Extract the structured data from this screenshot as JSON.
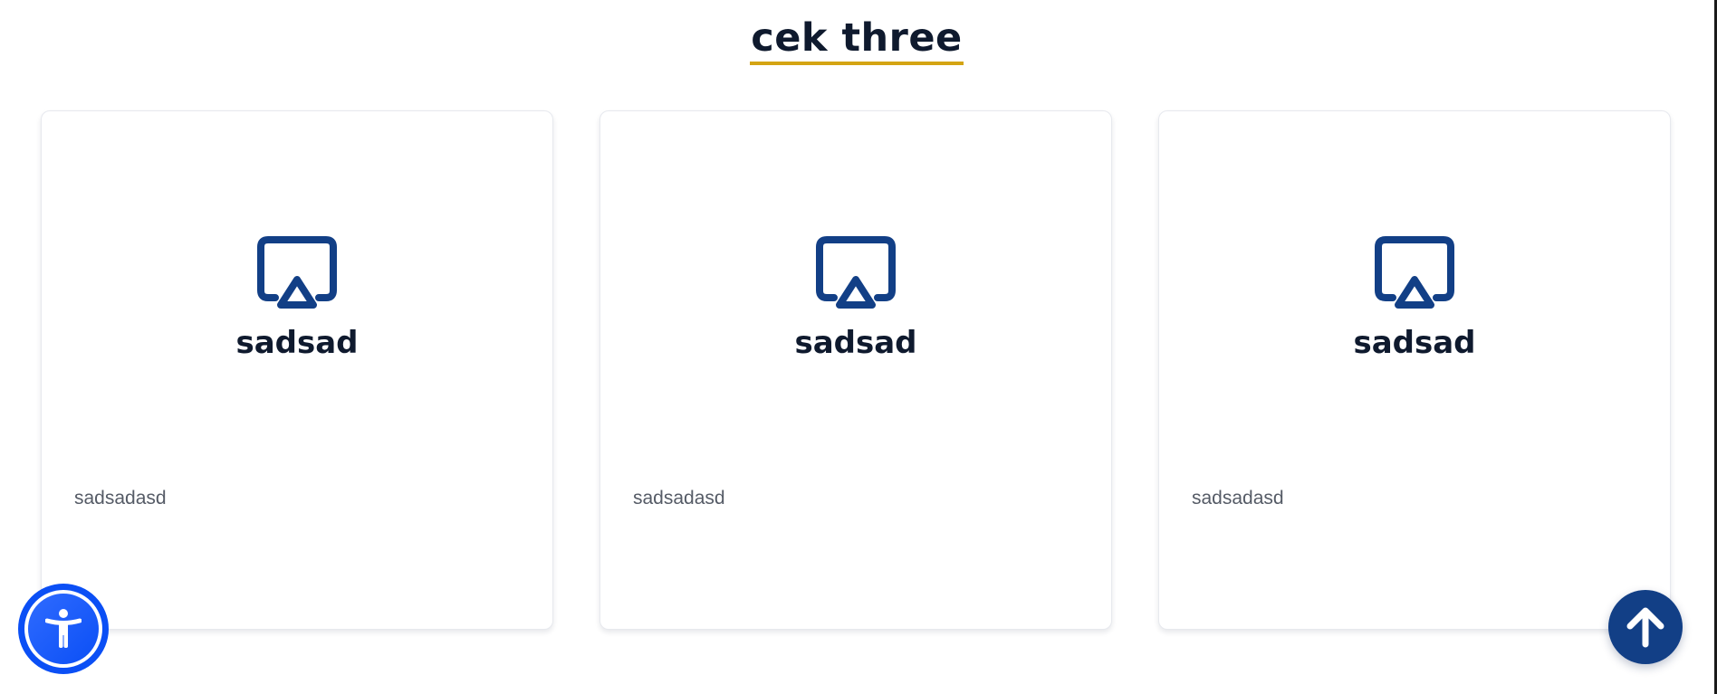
{
  "section": {
    "title": "cek three",
    "underline_color": "#d4a413",
    "title_color": "#0f1a2e"
  },
  "cards": [
    {
      "icon": "airplay-icon",
      "title": "sadsad",
      "text": "sadsadasd"
    },
    {
      "icon": "airplay-icon",
      "title": "sadsad",
      "text": "sadsadasd"
    },
    {
      "icon": "airplay-icon",
      "title": "sadsad",
      "text": "sadsadasd"
    }
  ],
  "accessibility_button": {
    "icon": "accessibility-person-icon",
    "color": "#0b4ff5"
  },
  "scroll_top_button": {
    "icon": "arrow-up-icon",
    "color": "#123f86"
  },
  "colors": {
    "icon_blue": "#123f86",
    "muted_text": "#555b66"
  }
}
